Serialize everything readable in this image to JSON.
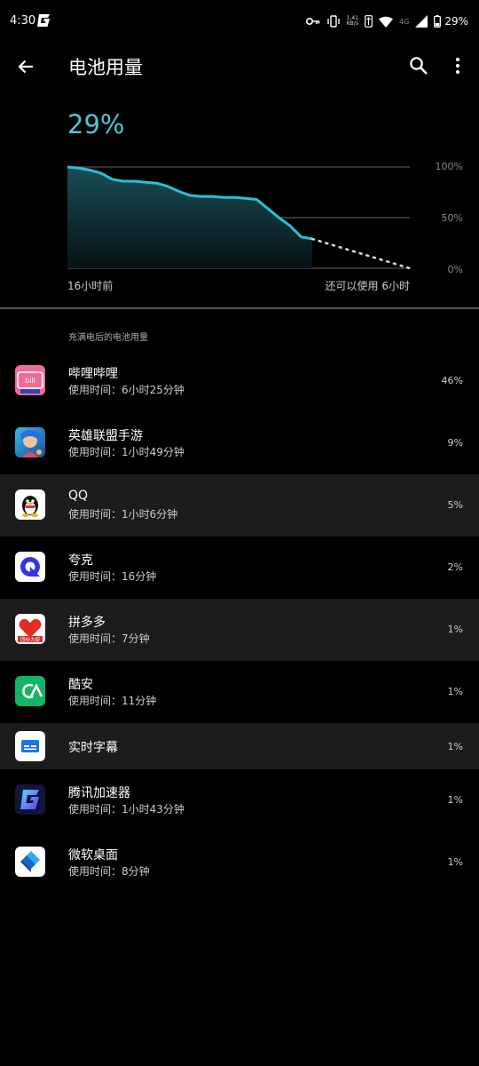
{
  "status_bar": {
    "time": "4:30",
    "net_speed_value": "1.41",
    "net_speed_unit": "KB/s",
    "network_type": "4G",
    "battery_text": "29%"
  },
  "app_bar": {
    "title": "电池用量"
  },
  "battery": {
    "level": "29%"
  },
  "chart_data": {
    "type": "area",
    "y_ticks": [
      "100%",
      "50%",
      "0%"
    ],
    "x_start_label": "16小时前",
    "x_end_label": "还可以使用 6小时",
    "ylim": [
      0,
      100
    ],
    "grid": true,
    "actual": [
      100,
      99,
      97,
      94,
      88,
      86,
      86,
      85,
      84,
      81,
      76,
      72,
      71,
      71,
      70,
      70,
      69,
      68,
      59,
      50,
      42,
      31,
      29
    ],
    "projected_end": 0,
    "accent_color": "#27c2d4"
  },
  "section": {
    "header": "充满电后的电池用量"
  },
  "apps": [
    {
      "name": "哔哩哔哩",
      "usage": "使用时间：6小时25分钟",
      "percent": "46%",
      "icon": "bilibili-icon"
    },
    {
      "name": "英雄联盟手游",
      "usage": "使用时间：1小时49分钟",
      "percent": "9%",
      "icon": "league-of-legends-icon"
    },
    {
      "name": "QQ",
      "usage": "使用时间：1小时6分钟",
      "percent": "5%",
      "icon": "qq-icon"
    },
    {
      "name": "夸克",
      "usage": "使用时间：16分钟",
      "percent": "2%",
      "icon": "quark-icon"
    },
    {
      "name": "拼多多",
      "usage": "使用时间：7分钟",
      "percent": "1%",
      "icon": "pinduoduo-icon",
      "icon_text": "团伙大促"
    },
    {
      "name": "酷安",
      "usage": "使用时间：11分钟",
      "percent": "1%",
      "icon": "coolapk-icon"
    },
    {
      "name": "实时字幕",
      "usage": "",
      "percent": "1%",
      "icon": "live-caption-icon"
    },
    {
      "name": "腾讯加速器",
      "usage": "使用时间：1小时43分钟",
      "percent": "1%",
      "icon": "tencent-accelerator-icon"
    },
    {
      "name": "微软桌面",
      "usage": "使用时间：8分钟",
      "percent": "1%",
      "icon": "microsoft-launcher-icon"
    }
  ]
}
